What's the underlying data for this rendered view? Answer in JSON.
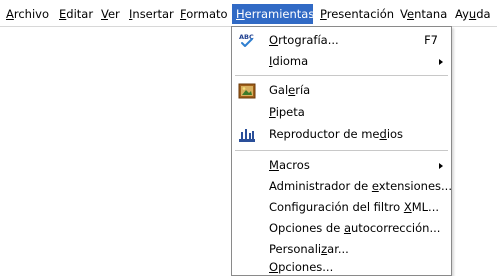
{
  "menubar": {
    "items": [
      {
        "pre": "",
        "mn": "A",
        "post": "rchivo"
      },
      {
        "pre": "",
        "mn": "E",
        "post": "ditar"
      },
      {
        "pre": "",
        "mn": "V",
        "post": "er"
      },
      {
        "pre": "",
        "mn": "I",
        "post": "nsertar"
      },
      {
        "pre": "",
        "mn": "F",
        "post": "ormato"
      },
      {
        "pre": "",
        "mn": "H",
        "post": "erramientas"
      },
      {
        "pre": "",
        "mn": "P",
        "post": "resentación"
      },
      {
        "pre": "V",
        "mn": "e",
        "post": "ntana"
      },
      {
        "pre": "Ay",
        "mn": "u",
        "post": "da"
      }
    ],
    "active_index": 5,
    "active_color": "#316ac5"
  },
  "dropdown": {
    "items": [
      {
        "pre": "",
        "mn": "O",
        "post": "rtografía...",
        "shortcut": "F7",
        "icon": "spellcheck-icon"
      },
      {
        "pre": "",
        "mn": "I",
        "post": "dioma",
        "submenu": true
      },
      {
        "pre": "Gal",
        "mn": "e",
        "post": "ría",
        "icon": "gallery-icon"
      },
      {
        "pre": "",
        "mn": "P",
        "post": "ipeta"
      },
      {
        "pre": "Reproductor de me",
        "mn": "d",
        "post": "ios",
        "icon": "media-player-icon"
      },
      {
        "pre": "",
        "mn": "M",
        "post": "acros",
        "submenu": true
      },
      {
        "pre": "Administrador de ",
        "mn": "e",
        "post": "xtensiones..."
      },
      {
        "pre": "Configuración del filtro ",
        "mn": "X",
        "post": "ML..."
      },
      {
        "pre": "Opciones de ",
        "mn": "a",
        "post": "utocorrección..."
      },
      {
        "pre": "Personali",
        "mn": "z",
        "post": "ar..."
      },
      {
        "pre": "",
        "mn": "O",
        "post": "pciones..."
      }
    ]
  }
}
